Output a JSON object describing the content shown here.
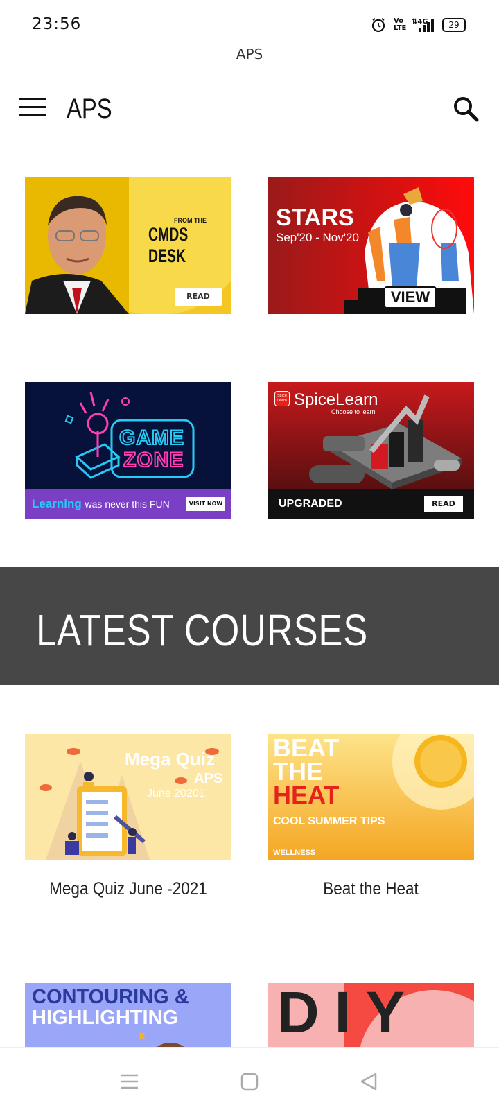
{
  "status_bar": {
    "time": "23:56",
    "network": "4G",
    "volte": "Vo LTE",
    "battery": "29"
  },
  "url_title": "APS",
  "app_bar": {
    "title": "APS",
    "menu_icon": "hamburger-menu-icon",
    "search_icon": "search-icon"
  },
  "banners": [
    {
      "name": "cmds-desk",
      "line1": "FROM THE",
      "line2": "CMDS DESK",
      "button": "READ"
    },
    {
      "name": "stars",
      "title": "STARS",
      "subtitle": "Sep'20 - Nov'20",
      "button": "VIEW"
    },
    {
      "name": "game-zone",
      "line1": "GAME",
      "line2": "ZONE",
      "tagline_strong": "Learning",
      "tagline_rest": "was never this FUN",
      "button": "VISIT NOW"
    },
    {
      "name": "spicelearn",
      "title": "SpiceLearn",
      "subtitle": "Choose to learn",
      "logo_text": "Spice Learn",
      "label": "UPGRADED",
      "button": "READ"
    }
  ],
  "latest_courses": {
    "heading": "LATEST COURSES",
    "courses": [
      {
        "title": "Mega Quiz June -2021",
        "thumb_line1": "Mega Quiz",
        "thumb_line2": "APS",
        "thumb_line3": "June 20201"
      },
      {
        "title": "Beat the Heat",
        "thumb_line1": "BEAT",
        "thumb_line2": "THE",
        "thumb_line3": "HEAT",
        "thumb_line4": "COOL SUMMER TIPS",
        "thumb_tag": "WELLNESS"
      },
      {
        "title": "",
        "thumb_line1": "CONTOURING &",
        "thumb_line2": "HIGHLIGHTING"
      },
      {
        "title": "",
        "thumb_line1": "DIY"
      }
    ]
  },
  "colors": {
    "dark_band": "#474747",
    "accent_red": "#e5231b",
    "accent_yellow": "#f3c623"
  }
}
